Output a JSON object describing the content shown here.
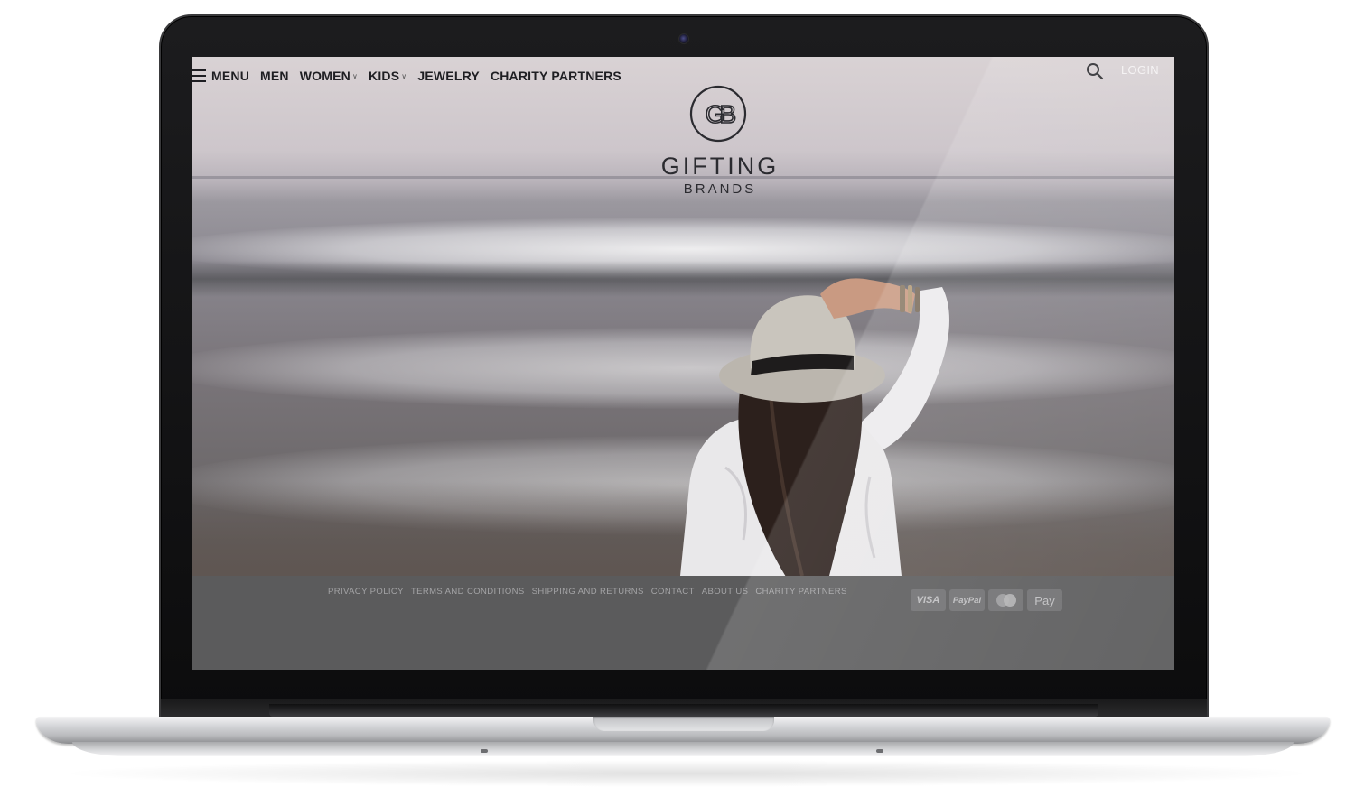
{
  "nav": {
    "menu_label": "MENU",
    "items": [
      {
        "label": "MEN",
        "has_caret": false
      },
      {
        "label": "WOMEN",
        "has_caret": true
      },
      {
        "label": "KIDS",
        "has_caret": true
      },
      {
        "label": "JEWELRY",
        "has_caret": false
      },
      {
        "label": "CHARITY PARTNERS",
        "has_caret": false
      }
    ],
    "caret_icon": "chevron-down-icon",
    "search_icon": "search-icon",
    "login_label": "LOGIN"
  },
  "logo": {
    "monogram": "GB",
    "title": "GIFTING",
    "subtitle": "BRANDS"
  },
  "footer": {
    "links": [
      "PRIVACY POLICY",
      "TERMS AND CONDITIONS",
      "SHIPPING AND RETURNS",
      "CONTACT",
      "ABOUT US",
      "CHARITY PARTNERS"
    ],
    "payment_methods": {
      "visa": "VISA",
      "paypal": "PayPal",
      "mastercard": "mastercard-icon",
      "applepay": " Pay"
    }
  },
  "colors": {
    "nav_text": "#1e1e22",
    "login_text": "#f4f2f3",
    "footer_bg": "#5b5b5c",
    "footer_link": "#a4a4a6",
    "logo_text": "#2b2b30"
  }
}
